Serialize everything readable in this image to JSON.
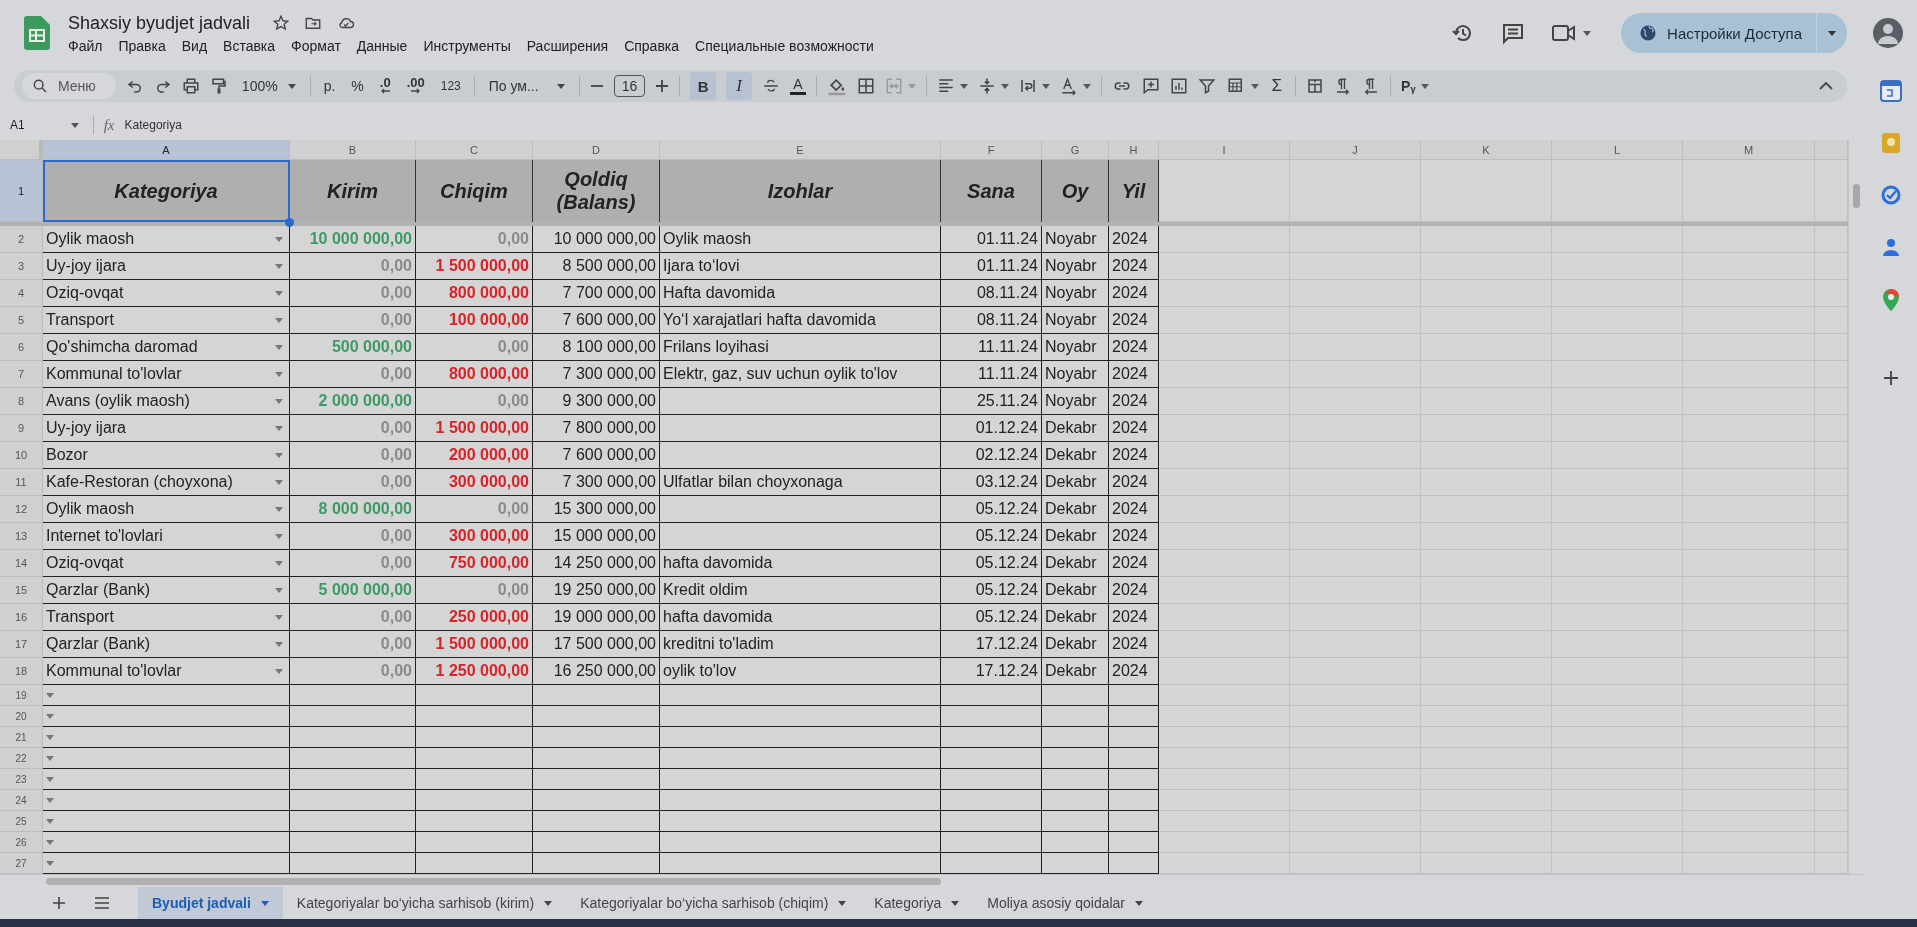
{
  "app": {
    "title": "Shaxsiy byudjet jadvali",
    "menu": [
      "Файл",
      "Правка",
      "Вид",
      "Вставка",
      "Формат",
      "Данные",
      "Инструменты",
      "Расширения",
      "Справка",
      "Специальные возможности"
    ],
    "share": "Настройки Доступа"
  },
  "toolbar": {
    "search": "Меню",
    "zoom": "100%",
    "currency": "р.",
    "percent": "%",
    "decrease_decimals": ".0",
    "increase_decimals": ".00",
    "number_format": "123",
    "font": "По ум...",
    "font_size": "16",
    "bold": {
      "label": "B",
      "on": true
    },
    "italic": {
      "label": "I",
      "on": true
    },
    "text_color": "A",
    "sum": "Σ",
    "input_tools": "Рᵧ"
  },
  "formula_bar": {
    "cell": "A1",
    "fx": "fx",
    "value": "Kategoriya"
  },
  "columns": [
    {
      "letter": "A",
      "selected": true
    },
    {
      "letter": "B",
      "selected": false
    },
    {
      "letter": "C",
      "selected": false
    },
    {
      "letter": "D",
      "selected": false
    },
    {
      "letter": "E",
      "selected": false
    },
    {
      "letter": "F",
      "selected": false
    },
    {
      "letter": "G",
      "selected": false
    },
    {
      "letter": "H",
      "selected": false
    },
    {
      "letter": "I",
      "selected": false
    },
    {
      "letter": "J",
      "selected": false
    },
    {
      "letter": "K",
      "selected": false
    },
    {
      "letter": "L",
      "selected": false
    },
    {
      "letter": "M",
      "selected": false
    }
  ],
  "header_row": {
    "n": "1",
    "selected": true,
    "cells": [
      {
        "text": "Kategoriya",
        "selected": true
      },
      {
        "text": "Kirim",
        "selected": false
      },
      {
        "text": "Chiqim",
        "selected": false
      },
      {
        "text": "Qoldiq (Balans)",
        "selected": false
      },
      {
        "text": "Izohlar",
        "selected": false
      },
      {
        "text": "Sana",
        "selected": false
      },
      {
        "text": "Oy",
        "selected": false
      },
      {
        "text": "Yil",
        "selected": false
      }
    ]
  },
  "rows": [
    {
      "n": "2",
      "category": "Oylik maosh",
      "income": {
        "text": "10 000 000,00",
        "muted": false
      },
      "expense": {
        "text": "0,00",
        "muted": true
      },
      "balance": "10 000 000,00",
      "note": "Oylik maosh",
      "date": "01.11.24",
      "month": "Noyabr",
      "year": "2024"
    },
    {
      "n": "3",
      "category": "Uy-joy ijara",
      "income": {
        "text": "0,00",
        "muted": true
      },
      "expense": {
        "text": "1 500 000,00",
        "muted": false
      },
      "balance": "8 500 000,00",
      "note": "Ijara to‘lovi",
      "date": "01.11.24",
      "month": "Noyabr",
      "year": "2024"
    },
    {
      "n": "4",
      "category": "Oziq-ovqat",
      "income": {
        "text": "0,00",
        "muted": true
      },
      "expense": {
        "text": "800 000,00",
        "muted": false
      },
      "balance": "7 700 000,00",
      "note": "Hafta davomida",
      "date": "08.11.24",
      "month": "Noyabr",
      "year": "2024"
    },
    {
      "n": "5",
      "category": "Transport",
      "income": {
        "text": "0,00",
        "muted": true
      },
      "expense": {
        "text": "100 000,00",
        "muted": false
      },
      "balance": "7 600 000,00",
      "note": "Yo‘l xarajatlari hafta davomida",
      "date": "08.11.24",
      "month": "Noyabr",
      "year": "2024"
    },
    {
      "n": "6",
      "category": "Qo'shimcha daromad",
      "income": {
        "text": "500 000,00",
        "muted": false
      },
      "expense": {
        "text": "0,00",
        "muted": true
      },
      "balance": "8 100 000,00",
      "note": "Frilans loyihasi",
      "date": "11.11.24",
      "month": "Noyabr",
      "year": "2024"
    },
    {
      "n": "7",
      "category": "Kommunal to'lovlar",
      "income": {
        "text": "0,00",
        "muted": true
      },
      "expense": {
        "text": "800 000,00",
        "muted": false
      },
      "balance": "7 300 000,00",
      "note": "Elektr, gaz, suv uchun oylik to'lov",
      "date": "11.11.24",
      "month": "Noyabr",
      "year": "2024"
    },
    {
      "n": "8",
      "category": "Avans (oylik maosh)",
      "income": {
        "text": "2 000 000,00",
        "muted": false
      },
      "expense": {
        "text": "0,00",
        "muted": true
      },
      "balance": "9 300 000,00",
      "date": "25.11.24",
      "month": "Noyabr",
      "year": "2024"
    },
    {
      "n": "9",
      "category": "Uy-joy ijara",
      "income": {
        "text": "0,00",
        "muted": true
      },
      "expense": {
        "text": "1 500 000,00",
        "muted": false
      },
      "balance": "7 800 000,00",
      "date": "01.12.24",
      "month": "Dekabr",
      "year": "2024"
    },
    {
      "n": "10",
      "category": "Bozor",
      "income": {
        "text": "0,00",
        "muted": true
      },
      "expense": {
        "text": "200 000,00",
        "muted": false
      },
      "balance": "7 600 000,00",
      "date": "02.12.24",
      "month": "Dekabr",
      "year": "2024"
    },
    {
      "n": "11",
      "category": "Kafe-Restoran (choyxona)",
      "income": {
        "text": "0,00",
        "muted": true
      },
      "expense": {
        "text": "300 000,00",
        "muted": false
      },
      "balance": "7 300 000,00",
      "note": "Ulfatlar bilan choyxonaga",
      "date": "03.12.24",
      "month": "Dekabr",
      "year": "2024"
    },
    {
      "n": "12",
      "category": "Oylik maosh",
      "income": {
        "text": "8 000 000,00",
        "muted": false
      },
      "expense": {
        "text": "0,00",
        "muted": true
      },
      "balance": "15 300 000,00",
      "date": "05.12.24",
      "month": "Dekabr",
      "year": "2024"
    },
    {
      "n": "13",
      "category": "Internet to'lovlari",
      "income": {
        "text": "0,00",
        "muted": true
      },
      "expense": {
        "text": "300 000,00",
        "muted": false
      },
      "balance": "15 000 000,00",
      "date": "05.12.24",
      "month": "Dekabr",
      "year": "2024"
    },
    {
      "n": "14",
      "category": "Oziq-ovqat",
      "income": {
        "text": "0,00",
        "muted": true
      },
      "expense": {
        "text": "750 000,00",
        "muted": false
      },
      "balance": "14 250 000,00",
      "note": "hafta davomida",
      "date": "05.12.24",
      "month": "Dekabr",
      "year": "2024"
    },
    {
      "n": "15",
      "category": "Qarzlar (Bank)",
      "income": {
        "text": "5 000 000,00",
        "muted": false
      },
      "expense": {
        "text": "0,00",
        "muted": true
      },
      "balance": "19 250 000,00",
      "note": "Kredit oldim",
      "date": "05.12.24",
      "month": "Dekabr",
      "year": "2024"
    },
    {
      "n": "16",
      "category": "Transport",
      "income": {
        "text": "0,00",
        "muted": true
      },
      "expense": {
        "text": "250 000,00",
        "muted": false
      },
      "balance": "19 000 000,00",
      "note": "hafta davomida",
      "date": "05.12.24",
      "month": "Dekabr",
      "year": "2024"
    },
    {
      "n": "17",
      "category": "Qarzlar (Bank)",
      "income": {
        "text": "0,00",
        "muted": true
      },
      "expense": {
        "text": "1 500 000,00",
        "muted": false
      },
      "balance": "17 500 000,00",
      "note": "kreditni to'ladim",
      "date": "17.12.24",
      "month": "Dekabr",
      "year": "2024"
    },
    {
      "n": "18",
      "category": "Kommunal to'lovlar",
      "income": {
        "text": "0,00",
        "muted": true
      },
      "expense": {
        "text": "1 250 000,00",
        "muted": false
      },
      "balance": "16 250 000,00",
      "note": "oylik to'lov",
      "date": "17.12.24",
      "month": "Dekabr",
      "year": "2024"
    }
  ],
  "empty_rows": [
    "19",
    "20",
    "21",
    "22",
    "23",
    "24",
    "25",
    "26",
    "27"
  ],
  "sheet_tabs": [
    {
      "label": "Byudjet jadvali",
      "selected": true
    },
    {
      "label": "Kategoriyalar bo‘yicha sarhisob (kirim)",
      "selected": false
    },
    {
      "label": "Kategoriyalar bo‘yicha sarhisob (chiqim)",
      "selected": false
    },
    {
      "label": "Kategoriya",
      "selected": false
    },
    {
      "label": "Moliya asosiy qoidalar",
      "selected": false
    }
  ]
}
